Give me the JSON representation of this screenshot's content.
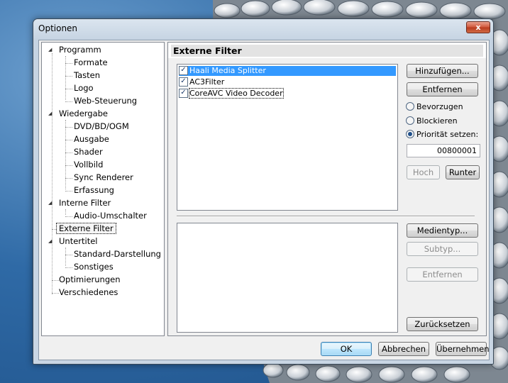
{
  "window": {
    "title": "Optionen",
    "close_glyph": "x"
  },
  "tree": {
    "items": [
      {
        "label": "Programm",
        "level": 0,
        "expanded": true
      },
      {
        "label": "Formate",
        "level": 1
      },
      {
        "label": "Tasten",
        "level": 1
      },
      {
        "label": "Logo",
        "level": 1
      },
      {
        "label": "Web-Steuerung",
        "level": 1
      },
      {
        "label": "Wiedergabe",
        "level": 0,
        "expanded": true
      },
      {
        "label": "DVD/BD/OGM",
        "level": 1
      },
      {
        "label": "Ausgabe",
        "level": 1
      },
      {
        "label": "Shader",
        "level": 1
      },
      {
        "label": "Vollbild",
        "level": 1
      },
      {
        "label": "Sync Renderer",
        "level": 1
      },
      {
        "label": "Erfassung",
        "level": 1
      },
      {
        "label": "Interne Filter",
        "level": 0,
        "expanded": true
      },
      {
        "label": "Audio-Umschalter",
        "level": 1
      },
      {
        "label": "Externe Filter",
        "level": 0,
        "selected": true
      },
      {
        "label": "Untertitel",
        "level": 0,
        "expanded": true
      },
      {
        "label": "Standard-Darstellung",
        "level": 1
      },
      {
        "label": "Sonstiges",
        "level": 1
      },
      {
        "label": "Optimierungen",
        "level": 0
      },
      {
        "label": "Verschiedenes",
        "level": 0
      }
    ]
  },
  "panel": {
    "header": "Externe Filter",
    "filters": [
      {
        "name": "Haali Media Splitter",
        "checked": true,
        "selected": true
      },
      {
        "name": "AC3Filter",
        "checked": true
      },
      {
        "name": "CoreAVC Video Decoder",
        "checked": true,
        "focused": true
      }
    ],
    "buttons": {
      "add": "Hinzufügen...",
      "remove": "Entfernen",
      "up": "Hoch",
      "down": "Runter",
      "media_type": "Medientyp...",
      "subtype": "Subtyp...",
      "remove2": "Entfernen",
      "reset": "Zurücksetzen"
    },
    "radios": {
      "prefer": "Bevorzugen",
      "block": "Blockieren",
      "priority": "Priorität setzen:",
      "selected": "priority"
    },
    "priority_value": "00800001"
  },
  "footer": {
    "ok": "OK",
    "cancel": "Abbrechen",
    "apply": "Übernehmen"
  },
  "colors": {
    "selection": "#3399ff",
    "background_sky": "#2f6aa6"
  }
}
